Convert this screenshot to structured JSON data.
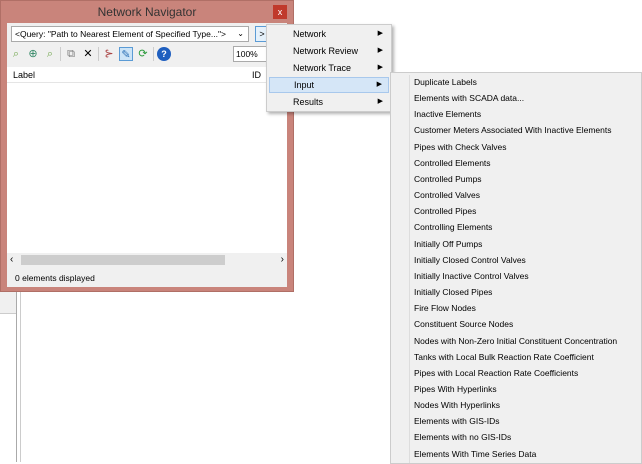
{
  "window": {
    "title": "Network Navigator",
    "close": "x"
  },
  "query": {
    "value": "<Query: \"Path to Nearest Element of Specified Type...\">",
    "go": ">"
  },
  "toolbar": {
    "zoom": "100%"
  },
  "list": {
    "col_label": "Label",
    "col_id": "ID"
  },
  "status": "0 elements displayed",
  "menu": [
    {
      "label": "Network"
    },
    {
      "label": "Network Review"
    },
    {
      "label": "Network Trace"
    },
    {
      "label": "Input"
    },
    {
      "label": "Results"
    }
  ],
  "submenu": [
    "Duplicate Labels",
    "Elements with SCADA data...",
    "Inactive Elements",
    "Customer Meters Associated With Inactive Elements",
    "Pipes with Check Valves",
    "Controlled Elements",
    "Controlled Pumps",
    "Controlled Valves",
    "Controlled Pipes",
    "Controlling Elements",
    "Initially Off Pumps",
    "Initially Closed Control Valves",
    "Initially Inactive Control Valves",
    "Initially Closed Pipes",
    "Fire Flow Nodes",
    "Constituent Source Nodes",
    "Nodes with Non-Zero Initial Constituent Concentration",
    "Tanks with Local Bulk Reaction Rate Coefficient",
    "Pipes with Local Reaction Rate Coefficients",
    "Pipes With Hyperlinks",
    "Nodes With Hyperlinks",
    "Elements with GIS-IDs",
    "Elements with no GIS-IDs",
    "Elements With Time Series Data"
  ]
}
